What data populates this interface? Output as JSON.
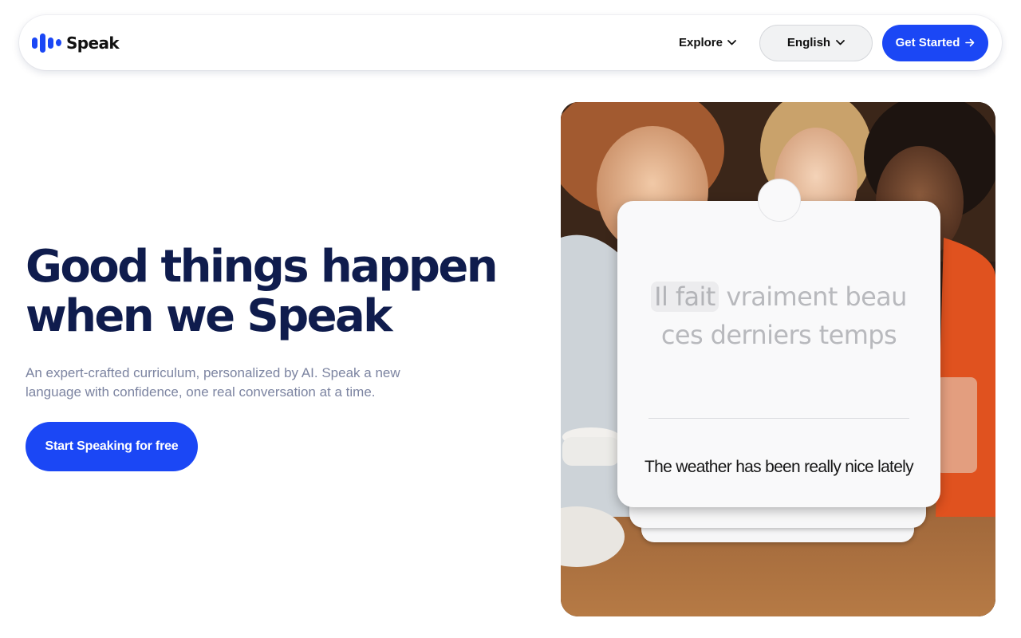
{
  "brand": {
    "name": "Speak",
    "color": "#1b47f5"
  },
  "nav": {
    "explore_label": "Explore",
    "language_label": "English",
    "get_started_label": "Get Started",
    "chevron_icon": "chevron-down-icon",
    "arrow_icon": "arrow-right-icon"
  },
  "hero": {
    "title_line1": "Good things happen",
    "title_line2": "when we Speak",
    "subtitle": "An expert-crafted curriculum, personalized by AI. Speak a new language with confidence, one real conversation at a time.",
    "cta_label": "Start Speaking for free"
  },
  "card": {
    "highlight_word": "Il fait",
    "foreign_rest_line1": " vraiment beau",
    "foreign_line2": "ces derniers temps",
    "translation": "The weather has been really nice lately"
  },
  "colors": {
    "title": "#0f1c4d",
    "subtitle": "#7c84a1",
    "primary_button": "#1b47f5"
  }
}
